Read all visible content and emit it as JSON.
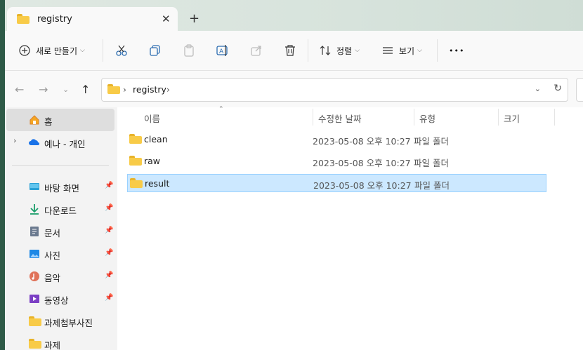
{
  "tab": {
    "title": "registry",
    "close": "✕",
    "new": "+"
  },
  "toolbar": {
    "new_label": "새로 만들기",
    "sort_label": "정렬",
    "view_label": "보기",
    "more": "•••"
  },
  "address": {
    "crumbs": [
      "registry"
    ]
  },
  "sidebar": {
    "home": "홈",
    "onedrive": "예나 - 개인",
    "quick": [
      {
        "label": "바탕 화면",
        "icon": "desktop-icon",
        "pinned": true
      },
      {
        "label": "다운로드",
        "icon": "download-icon",
        "pinned": true
      },
      {
        "label": "문서",
        "icon": "document-icon",
        "pinned": true
      },
      {
        "label": "사진",
        "icon": "pictures-icon",
        "pinned": true
      },
      {
        "label": "음악",
        "icon": "music-icon",
        "pinned": true
      },
      {
        "label": "동영상",
        "icon": "video-icon",
        "pinned": true
      },
      {
        "label": "과제첨부사진",
        "icon": "folder-icon",
        "pinned": false
      },
      {
        "label": "과제",
        "icon": "folder-icon",
        "pinned": false
      }
    ]
  },
  "columns": {
    "name": "이름",
    "date": "수정한 날짜",
    "type": "유형",
    "size": "크기"
  },
  "files": [
    {
      "name": "clean",
      "date": "2023-05-08 오후 10:27",
      "type": "파일 폴더"
    },
    {
      "name": "raw",
      "date": "2023-05-08 오후 10:27",
      "type": "파일 폴더"
    },
    {
      "name": "result",
      "date": "2023-05-08 오후 10:27",
      "type": "파일 폴더"
    }
  ]
}
